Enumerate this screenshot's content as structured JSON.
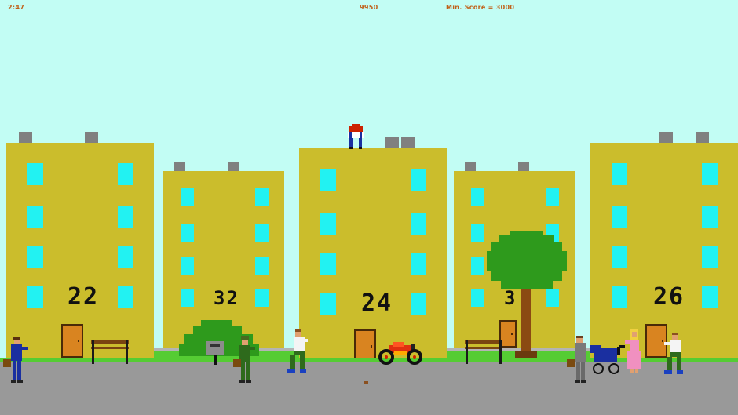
{
  "hud": {
    "time": "2:47",
    "score": "9950",
    "min_score": "Min. Score = 3000"
  },
  "buildings": [
    {
      "number": "22"
    },
    {
      "number": "32"
    },
    {
      "number": "24"
    },
    {
      "number": "3"
    },
    {
      "number": "26"
    }
  ],
  "colors": {
    "sky": "#c2fdf4",
    "building": "#cbbd2c",
    "window": "#22f2f2",
    "door": "#d98420",
    "grass": "#55cc33",
    "road": "#999999",
    "hud_text": "#c06018"
  },
  "sprites": [
    "player-character",
    "pedestrian-businessman-blue",
    "pedestrian-soldier-green",
    "pedestrian-white-shirt",
    "pedestrian-grey-suit",
    "woman-in-pink",
    "baby-stroller",
    "pedestrian-running",
    "motorcycle",
    "park-bench",
    "mailbox",
    "bush",
    "tree"
  ]
}
